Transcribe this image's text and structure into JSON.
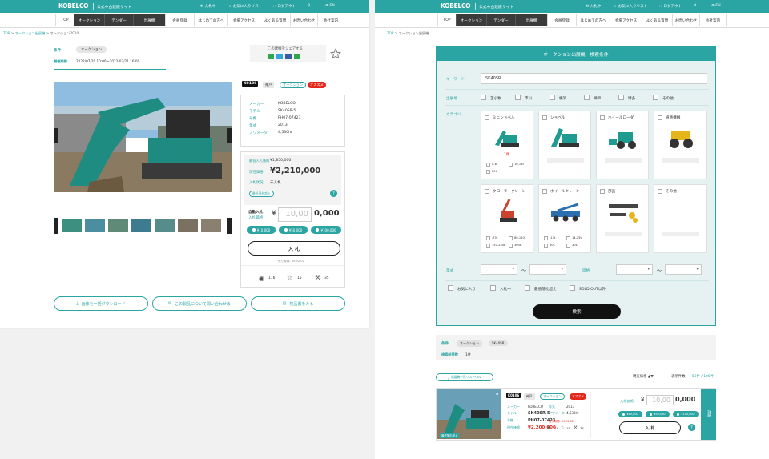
{
  "header": {
    "logo": "KOBELCO",
    "site_title": "公式中古建機サイト",
    "links": [
      "入札中",
      "お気に入りリスト",
      "ログアウト"
    ],
    "lang": "EN"
  },
  "nav": [
    "TOP",
    "オークション",
    "テンダー",
    "出展機",
    "会員登録",
    "はじめての方へ",
    "会場アクセス",
    "よくある質問",
    "お問い合わせ",
    "会社案内"
  ],
  "left": {
    "breadcrumb": [
      "TOP",
      "オークション出展機",
      "オークション2010"
    ],
    "condition_label": "条件",
    "condition_value": "オークション",
    "period_label": "開催期間",
    "period_value": "2022/07/20 10:00〜2022/07/21 16:00",
    "share_label": "この建機をシェアする",
    "tags": {
      "id": "K0106",
      "place": "神戸",
      "type": "オークション",
      "recommend": "オススメ"
    },
    "specs": [
      {
        "k": "メーカー",
        "v": "KOBELCO"
      },
      {
        "k": "モデル",
        "v": "SK40SR-5"
      },
      {
        "k": "号機",
        "v": "PH07-07423"
      },
      {
        "k": "年式",
        "v": "2013"
      },
      {
        "k": "アワメータ",
        "v": "4,530hr"
      }
    ],
    "min_bid_label": "最低入札価格",
    "min_bid": "¥1,850,000",
    "current_label": "現在価格",
    "current_price": "¥2,210,000",
    "status_label": "入札状況",
    "status_value": "未入札",
    "over_badge": "最低落札超え",
    "auto_label": "自動入札",
    "bid_label": "入札価格",
    "yen": "¥",
    "bid_placeholder": "10,00",
    "bid_suffix": "0,000",
    "increments": [
      "¥10,000",
      "¥50,000",
      "¥100,000"
    ],
    "bid_button": "入 札",
    "remain": "残り時間: 00:52:02",
    "views": "116",
    "favs": "15",
    "bids": "35",
    "actions": [
      "画像を一括ダウンロード",
      "この製品について問い合わせる",
      "検品書をみる"
    ]
  },
  "right": {
    "breadcrumb": [
      "TOP",
      "オークション出展機"
    ],
    "search_title": "オークション出展機　検索条件",
    "keyword_label": "キーワード",
    "keyword_value": "SK40SR",
    "location_label": "出展地",
    "locations": [
      "苫小牧",
      "市川",
      "横浜",
      "神戸",
      "博多",
      "その他"
    ],
    "category_label": "カテゴリ",
    "categories": [
      {
        "name": "ミニショベル",
        "count": "1件",
        "opts": [
          "0-6t",
          "10-15t",
          "20t"
        ]
      },
      {
        "name": "ショベル",
        "count": "",
        "opts": []
      },
      {
        "name": "ホイールローダ",
        "count": "",
        "opts": []
      },
      {
        "name": "道路機械",
        "count": "",
        "opts": []
      },
      {
        "name": "クローラークレーン",
        "count": "",
        "opts": [
          "-70t",
          "80-120t",
          "150-250t",
          "300t-"
        ]
      },
      {
        "name": "ホイールクレーン",
        "count": "",
        "opts": [
          "-13t",
          "14-25t",
          "50t-",
          "30t-"
        ]
      },
      {
        "name": "部品",
        "count": "",
        "opts": []
      },
      {
        "name": "その他",
        "count": "",
        "opts": []
      }
    ],
    "year_label": "年式",
    "price_label": "価格",
    "tilde": "〜",
    "extra_filters": [
      "お気に入り",
      "入札中",
      "最低落札超え",
      "SOLD OUT以外"
    ],
    "search_button": "検索",
    "cond_label": "条件",
    "cond_values": [
      "オークション",
      "SK40SR"
    ],
    "count_label": "検索結果数",
    "count_value": "1件",
    "csv_button": "出展機一覧リストCSV",
    "sort_label": "現在価格",
    "sort_arrows": "▲▼",
    "per_page_label": "表示件数",
    "per_page": "50件 / 100件",
    "item": {
      "id": "K0106",
      "place": "神戸",
      "type": "オークション",
      "recommend": "オススメ",
      "badge": "最低落札超え",
      "specs": [
        {
          "k": "メーカー",
          "v": "KOBELCO"
        },
        {
          "k": "モデル",
          "v": "SK40SR-5"
        },
        {
          "k": "号機",
          "v": "PH07-07423"
        },
        {
          "k": "現在価格",
          "v": "¥2,200,000"
        }
      ],
      "specs2": [
        {
          "k": "年式",
          "v": "2013"
        },
        {
          "k": "アワメータ",
          "v": "4,530hr"
        }
      ],
      "remain": "残り時間: 00:52:02",
      "views": "116",
      "favs": "15",
      "bids": "34",
      "bid_label": "入札価格",
      "yen": "¥",
      "bid_placeholder": "10,00",
      "bid_suffix": "0,000",
      "increments": [
        "¥10,000",
        "¥50,000",
        "¥100,000"
      ],
      "bid_button": "入 札",
      "detail_button": "詳細"
    }
  },
  "colors": {
    "accent": "#2aa5a4",
    "dark": "#3b3b3b",
    "red": "#e4271b"
  }
}
